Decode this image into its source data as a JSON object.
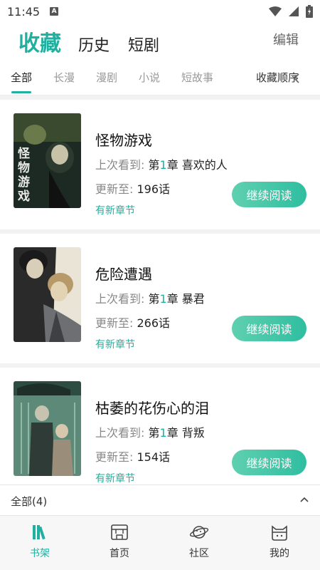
{
  "status": {
    "time": "11:45",
    "notif": "A"
  },
  "header": {
    "tabs": [
      {
        "label": "收藏",
        "active": true
      },
      {
        "label": "历史",
        "active": false
      },
      {
        "label": "短剧",
        "active": false
      }
    ],
    "edit_label": "编辑"
  },
  "subtabs": {
    "items": [
      {
        "label": "全部",
        "active": true
      },
      {
        "label": "长漫",
        "active": false
      },
      {
        "label": "漫剧",
        "active": false
      },
      {
        "label": "小说",
        "active": false
      },
      {
        "label": "短故事",
        "active": false
      }
    ],
    "sort_label": "收藏顺序"
  },
  "books": [
    {
      "title": "怪物游戏",
      "last_read_label": "上次看到:",
      "chapter_prefix": "第",
      "chapter_num": "1",
      "chapter_suffix": "章 喜欢的人",
      "update_label": "更新至:",
      "update_value": "196话",
      "new_label": "有新章节",
      "btn_label": "继续阅读",
      "cover_text": "怪物游戏"
    },
    {
      "title": "危险遭遇",
      "last_read_label": "上次看到:",
      "chapter_prefix": "第",
      "chapter_num": "1",
      "chapter_suffix": "章 暴君",
      "update_label": "更新至:",
      "update_value": "266话",
      "new_label": "有新章节",
      "btn_label": "继续阅读",
      "cover_text": ""
    },
    {
      "title": "枯萎的花伤心的泪",
      "last_read_label": "上次看到:",
      "chapter_prefix": "第",
      "chapter_num": "1",
      "chapter_suffix": "章 背叛",
      "update_label": "更新至:",
      "update_value": "154话",
      "new_label": "有新章节",
      "btn_label": "继续阅读",
      "cover_text": ""
    }
  ],
  "summary": {
    "label": "全部(4)"
  },
  "nav": [
    {
      "label": "书架",
      "icon": "bookshelf-icon",
      "active": true
    },
    {
      "label": "首页",
      "icon": "home-icon",
      "active": false
    },
    {
      "label": "社区",
      "icon": "planet-icon",
      "active": false
    },
    {
      "label": "我的",
      "icon": "cat-icon",
      "active": false
    }
  ],
  "colors": {
    "accent": "#1fb0a0",
    "button": "#3cc4a4"
  }
}
